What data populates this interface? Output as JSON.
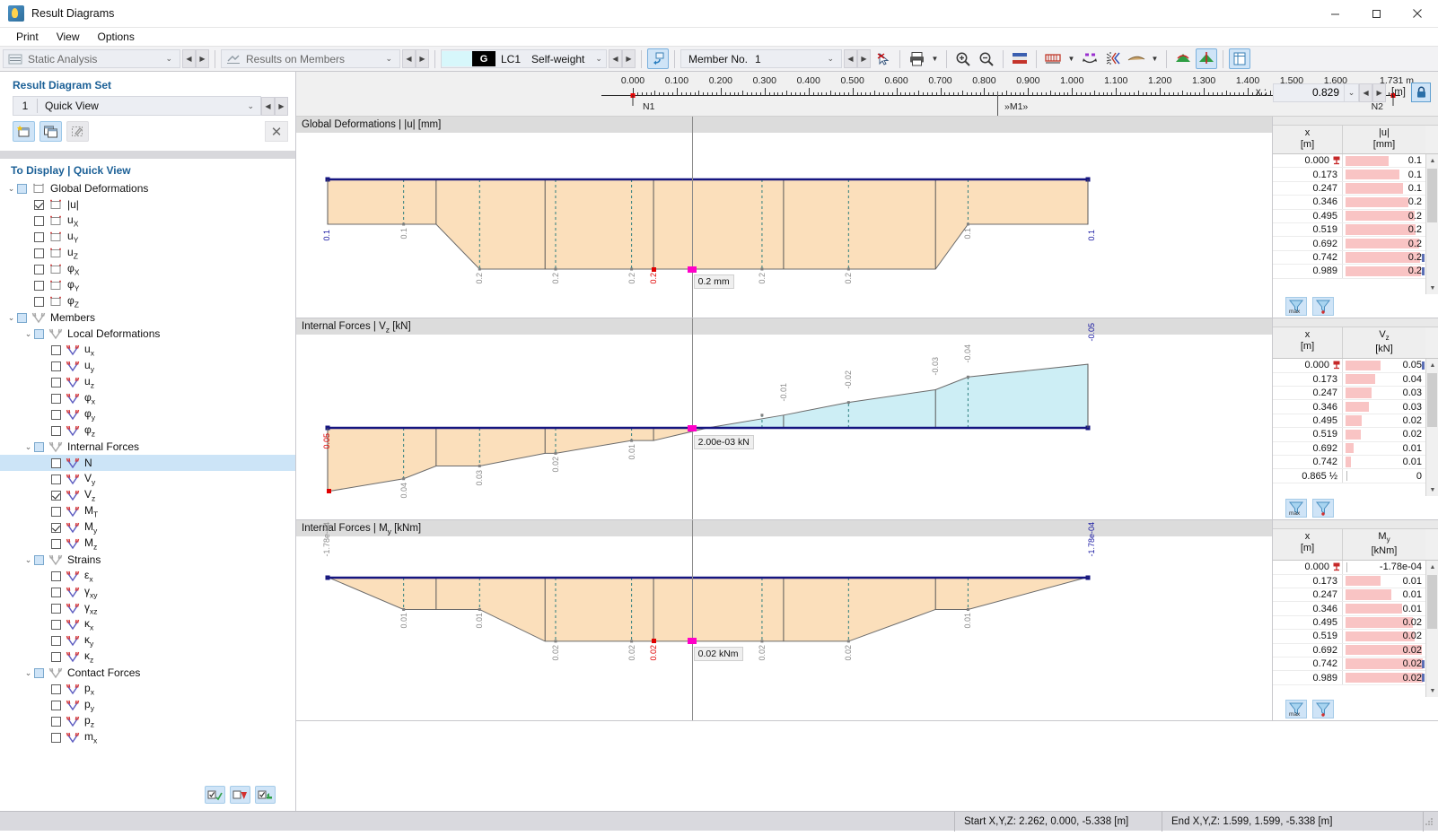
{
  "window": {
    "title": "Result Diagrams",
    "minimize": "—",
    "maximize": "▢",
    "close": "✕"
  },
  "menu": [
    "Print",
    "View",
    "Options"
  ],
  "toolbar": {
    "analysis_type": "Static Analysis",
    "results_type": "Results on Members",
    "load_case_tag": "G",
    "load_case_id": "LC1",
    "load_case_name": "Self-weight",
    "member_label": "Member No.",
    "member_value": "1",
    "icons": [
      "deselect-icon",
      "print-icon",
      "zoom-in-icon",
      "zoom-out-icon",
      "color-scale-icon",
      "diagram-style-icon",
      "swap-direction-icon",
      "section-cut-icon",
      "smoothing-icon",
      "surface-results-icon",
      "member-results-icon",
      "table-view-icon"
    ]
  },
  "left_panel": {
    "result_set_title": "Result Diagram Set",
    "set_number": "1",
    "set_name": "Quick View",
    "buttons": [
      "new-set-button",
      "copy-set-button",
      "edit-set-button",
      "delete-set-button"
    ],
    "to_display_title": "To Display | Quick View",
    "tree": [
      {
        "label": "Global Deformations",
        "level": 0,
        "expander": "v",
        "check": "tri",
        "icon": "surface-icon"
      },
      {
        "label": "|u|",
        "level": 1,
        "check": "checked",
        "icon": "surface-red-icon"
      },
      {
        "label": "u",
        "sub": "X",
        "level": 1,
        "check": "off",
        "icon": "surface-red-icon"
      },
      {
        "label": "u",
        "sub": "Y",
        "level": 1,
        "check": "off",
        "icon": "surface-red-icon"
      },
      {
        "label": "u",
        "sub": "Z",
        "level": 1,
        "check": "off",
        "icon": "surface-red-icon"
      },
      {
        "label": "φ",
        "sub": "X",
        "level": 1,
        "check": "off",
        "icon": "surface-red-icon"
      },
      {
        "label": "φ",
        "sub": "Y",
        "level": 1,
        "check": "off",
        "icon": "surface-red-icon"
      },
      {
        "label": "φ",
        "sub": "Z",
        "level": 1,
        "check": "off",
        "icon": "surface-red-icon"
      },
      {
        "label": "Members",
        "level": 0,
        "expander": "v",
        "check": "tri",
        "icon": "member-icon"
      },
      {
        "label": "Local Deformations",
        "level": 1,
        "expander": "v",
        "check": "tri",
        "icon": "member-icon"
      },
      {
        "label": "u",
        "sub": "x",
        "level": 2,
        "check": "off",
        "icon": "member-red-icon"
      },
      {
        "label": "u",
        "sub": "y",
        "level": 2,
        "check": "off",
        "icon": "member-red-icon"
      },
      {
        "label": "u",
        "sub": "z",
        "level": 2,
        "check": "off",
        "icon": "member-red-icon"
      },
      {
        "label": "φ",
        "sub": "x",
        "level": 2,
        "check": "off",
        "icon": "member-red-icon"
      },
      {
        "label": "φ",
        "sub": "y",
        "level": 2,
        "check": "off",
        "icon": "member-red-icon"
      },
      {
        "label": "φ",
        "sub": "z",
        "level": 2,
        "check": "off",
        "icon": "member-red-icon"
      },
      {
        "label": "Internal Forces",
        "level": 1,
        "expander": "v",
        "check": "tri",
        "icon": "member-icon"
      },
      {
        "label": "N",
        "level": 2,
        "check": "off",
        "icon": "member-red-icon",
        "selected": true
      },
      {
        "label": "V",
        "sub": "y",
        "level": 2,
        "check": "off",
        "icon": "member-red-icon"
      },
      {
        "label": "V",
        "sub": "z",
        "level": 2,
        "check": "checked",
        "icon": "member-red-icon"
      },
      {
        "label": "M",
        "sub": "T",
        "level": 2,
        "check": "off",
        "icon": "member-red-icon"
      },
      {
        "label": "M",
        "sub": "y",
        "level": 2,
        "check": "checked",
        "icon": "member-red-icon"
      },
      {
        "label": "M",
        "sub": "z",
        "level": 2,
        "check": "off",
        "icon": "member-red-icon"
      },
      {
        "label": "Strains",
        "level": 1,
        "expander": "v",
        "check": "tri",
        "icon": "member-icon"
      },
      {
        "label": "ε",
        "sub": "x",
        "level": 2,
        "check": "off",
        "icon": "member-red-icon"
      },
      {
        "label": "γ",
        "sub": "xy",
        "level": 2,
        "check": "off",
        "icon": "member-red-icon"
      },
      {
        "label": "γ",
        "sub": "xz",
        "level": 2,
        "check": "off",
        "icon": "member-red-icon"
      },
      {
        "label": "κ",
        "sub": "x",
        "level": 2,
        "check": "off",
        "icon": "member-red-icon"
      },
      {
        "label": "κ",
        "sub": "y",
        "level": 2,
        "check": "off",
        "icon": "member-red-icon"
      },
      {
        "label": "κ",
        "sub": "z",
        "level": 2,
        "check": "off",
        "icon": "member-red-icon"
      },
      {
        "label": "Contact Forces",
        "level": 1,
        "expander": "v",
        "check": "tri",
        "icon": "member-icon"
      },
      {
        "label": "p",
        "sub": "x",
        "level": 2,
        "check": "off",
        "icon": "member-red-icon"
      },
      {
        "label": "p",
        "sub": "y",
        "level": 2,
        "check": "off",
        "icon": "member-red-icon"
      },
      {
        "label": "p",
        "sub": "z",
        "level": 2,
        "check": "off",
        "icon": "member-red-icon"
      },
      {
        "label": "m",
        "sub": "x",
        "level": 2,
        "check": "off",
        "icon": "member-red-icon"
      }
    ],
    "footer_buttons": [
      "check-all-button",
      "uncheck-all-button",
      "invert-selection-button"
    ]
  },
  "ruler": {
    "ticks": [
      "0.000",
      "0.100",
      "0.200",
      "0.300",
      "0.400",
      "0.500",
      "0.600",
      "0.700",
      "0.800",
      "0.900",
      "1.000",
      "1.100",
      "1.200",
      "1.300",
      "1.400",
      "1.500",
      "1.600"
    ],
    "end_label": "1.731 m",
    "start_node": "N1",
    "end_node": "N2",
    "member_label": "»M1»",
    "x_label": "x :",
    "x_value": "0.829",
    "x_unit": "[m]",
    "lock_icon": "lock-icon"
  },
  "chart_data": [
    {
      "type": "area",
      "title": "Global Deformations | |u| [mm]",
      "quantity": "|u|",
      "unit": "mm",
      "xlabel": "x [m]",
      "xlim": [
        0,
        1.731
      ],
      "fill_color": "#fbdfbb",
      "axis_color": "#151580",
      "cursor_value": "0.2 mm",
      "cursor_x": 0.829,
      "node_start_label": "0.1",
      "node_end_label": "0.1",
      "extreme_label": "0.2",
      "inner_labels": [
        "0.1",
        "0.2",
        "0.2",
        "0.2",
        "0.2",
        "0.2",
        "0.2",
        "0.1"
      ],
      "x": [
        0.0,
        0.173,
        0.247,
        0.346,
        0.495,
        0.519,
        0.692,
        0.742,
        0.989,
        1.038,
        1.186,
        1.384,
        1.458,
        1.731
      ],
      "values": [
        0.1,
        0.1,
        0.1,
        0.2,
        0.2,
        0.2,
        0.2,
        0.2,
        0.2,
        0.2,
        0.2,
        0.2,
        0.1,
        0.1
      ]
    },
    {
      "type": "area",
      "title": "Internal Forces | V_z [kN]",
      "quantity": "Vz",
      "unit": "kN",
      "xlabel": "x [m]",
      "xlim": [
        0,
        1.731
      ],
      "fill_color_pos": "#fbdfbb",
      "fill_color_neg": "#cdeef5",
      "axis_color": "#151580",
      "cursor_value": "2.00e-03 kN",
      "cursor_x": 0.829,
      "node_start_label": "0.05",
      "node_end_label": "-0.05",
      "inner_labels_left": [
        "0.04",
        "0.03",
        "0.02",
        "0.01"
      ],
      "inner_labels_right": [
        "-0.01",
        "-0.02",
        "-0.03",
        "-0.04"
      ],
      "x": [
        0.0,
        0.173,
        0.247,
        0.346,
        0.495,
        0.519,
        0.692,
        0.742,
        0.865,
        1.038,
        1.186,
        1.384,
        1.458,
        1.731
      ],
      "values": [
        0.05,
        0.04,
        0.03,
        0.03,
        0.02,
        0.02,
        0.01,
        0.01,
        0.0,
        -0.01,
        -0.02,
        -0.03,
        -0.04,
        -0.05
      ]
    },
    {
      "type": "area",
      "title": "Internal Forces | M_y [kNm]",
      "quantity": "My",
      "unit": "kNm",
      "xlabel": "x [m]",
      "xlim": [
        0,
        1.731
      ],
      "fill_color": "#fbdfbb",
      "axis_color": "#151580",
      "cursor_value": "0.02 kNm",
      "cursor_x": 0.829,
      "node_start_label": "-1.78e-04",
      "node_end_label": "-1.78e-04",
      "extreme_label": "0.02",
      "inner_labels": [
        "0.01",
        "0.01",
        "0.02",
        "0.02",
        "0.02",
        "0.02",
        "0.01"
      ],
      "x": [
        0.0,
        0.173,
        0.247,
        0.346,
        0.495,
        0.519,
        0.692,
        0.742,
        0.989,
        1.038,
        1.186,
        1.384,
        1.458,
        1.731
      ],
      "values": [
        -0.000178,
        0.01,
        0.01,
        0.01,
        0.02,
        0.02,
        0.02,
        0.02,
        0.02,
        0.02,
        0.02,
        0.01,
        0.01,
        -0.000178
      ]
    }
  ],
  "tables": [
    {
      "headers": {
        "x": "x",
        "x_unit": "[m]",
        "v": "|u|",
        "v_unit": "[mm]"
      },
      "rows": [
        {
          "x": "0.000",
          "v": "0.1",
          "bar": 52,
          "support": true
        },
        {
          "x": "0.173",
          "v": "0.1",
          "bar": 65
        },
        {
          "x": "0.247",
          "v": "0.1",
          "bar": 70
        },
        {
          "x": "0.346",
          "v": "0.2",
          "bar": 76
        },
        {
          "x": "0.495",
          "v": "0.2",
          "bar": 84
        },
        {
          "x": "0.519",
          "v": "0.2",
          "bar": 85
        },
        {
          "x": "0.692",
          "v": "0.2",
          "bar": 89
        },
        {
          "x": "0.742",
          "v": "0.2",
          "bar": 90,
          "mark": true
        },
        {
          "x": "0.989",
          "v": "0.2",
          "bar": 91,
          "mark": true
        }
      ],
      "footer_buttons": [
        "filter-max-button",
        "filter-support-button"
      ]
    },
    {
      "headers": {
        "x": "x",
        "x_unit": "[m]",
        "v": "V",
        "v_sub": "z",
        "v_unit": "[kN]"
      },
      "rows": [
        {
          "x": "0.000",
          "v": "0.05",
          "bar": 42,
          "support": true,
          "mark": true
        },
        {
          "x": "0.173",
          "v": "0.04",
          "bar": 36
        },
        {
          "x": "0.247",
          "v": "0.03",
          "bar": 31
        },
        {
          "x": "0.346",
          "v": "0.03",
          "bar": 28
        },
        {
          "x": "0.495",
          "v": "0.02",
          "bar": 20
        },
        {
          "x": "0.519",
          "v": "0.02",
          "bar": 19
        },
        {
          "x": "0.692",
          "v": "0.01",
          "bar": 10
        },
        {
          "x": "0.742",
          "v": "0.01",
          "bar": 7
        },
        {
          "x": "0.865 ½",
          "v": "0",
          "bar": 0
        }
      ],
      "footer_buttons": [
        "filter-max-button",
        "filter-support-button"
      ]
    },
    {
      "headers": {
        "x": "x",
        "x_unit": "[m]",
        "v": "M",
        "v_sub": "y",
        "v_unit": "[kNm]"
      },
      "rows": [
        {
          "x": "0.000",
          "v": "-1.78e-04",
          "bar": 0,
          "support": true
        },
        {
          "x": "0.173",
          "v": "0.01",
          "bar": 42
        },
        {
          "x": "0.247",
          "v": "0.01",
          "bar": 55
        },
        {
          "x": "0.346",
          "v": "0.01",
          "bar": 68
        },
        {
          "x": "0.495",
          "v": "0.02",
          "bar": 82
        },
        {
          "x": "0.519",
          "v": "0.02",
          "bar": 84
        },
        {
          "x": "0.692",
          "v": "0.02",
          "bar": 92
        },
        {
          "x": "0.742",
          "v": "0.02",
          "bar": 93,
          "mark": true
        },
        {
          "x": "0.989",
          "v": "0.02",
          "bar": 94,
          "mark": true
        }
      ],
      "footer_buttons": [
        "filter-max-button",
        "filter-support-button"
      ]
    }
  ],
  "statusbar": {
    "start_coords": "Start X,Y,Z: 2.262, 0.000, -5.338 [m]",
    "end_coords": "End X,Y,Z: 1.599, 1.599, -5.338 [m]"
  }
}
